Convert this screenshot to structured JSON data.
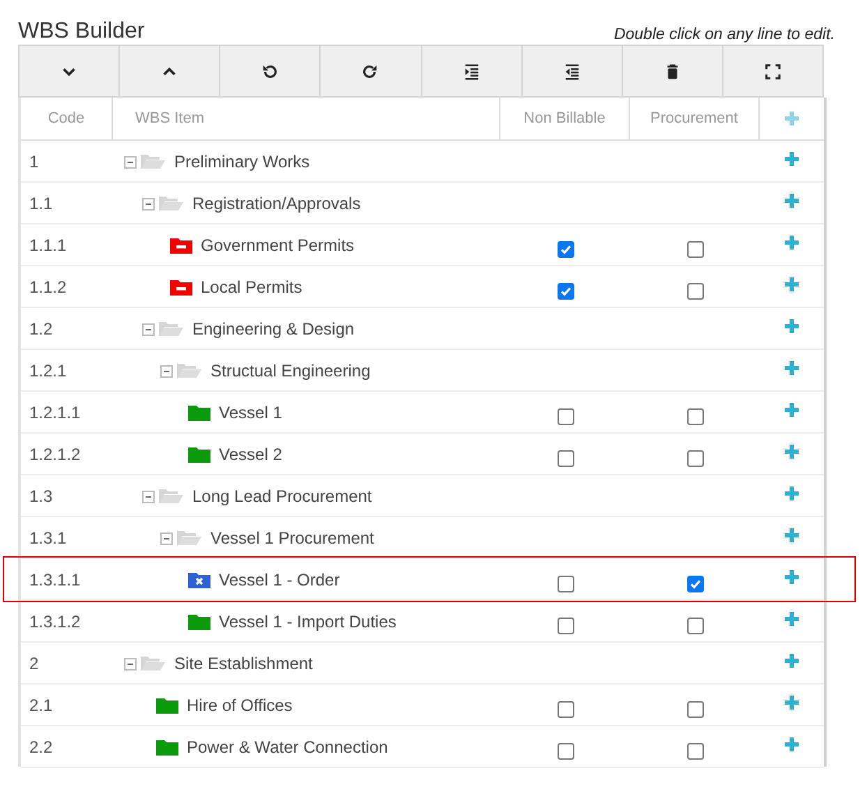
{
  "title": "WBS Builder",
  "hint": "Double click on any line to edit.",
  "toolbar": [
    {
      "kind": "down"
    },
    {
      "kind": "up"
    },
    {
      "kind": "undo"
    },
    {
      "kind": "redo"
    },
    {
      "kind": "indent"
    },
    {
      "kind": "outdent"
    },
    {
      "kind": "delete"
    },
    {
      "kind": "fullscreen"
    }
  ],
  "columns": [
    "Code",
    "WBS Item",
    "Non Billable",
    "Procurement"
  ],
  "items": [
    {
      "code": "1",
      "name": "Preliminary Works",
      "kind": "group",
      "expanded": true,
      "highlighted": false,
      "children": [
        {
          "code": "1.1",
          "name": "Registration/Approvals",
          "kind": "group",
          "expanded": true,
          "highlighted": false,
          "children": [
            {
              "code": "1.1.1",
              "name": "Government Permits",
              "kind": "blocked",
              "non_billable": true,
              "procurement": false,
              "highlighted": false
            },
            {
              "code": "1.1.2",
              "name": "Local Permits",
              "kind": "blocked",
              "non_billable": true,
              "procurement": false,
              "highlighted": false
            }
          ]
        },
        {
          "code": "1.2",
          "name": "Engineering & Design",
          "kind": "group",
          "expanded": true,
          "highlighted": false,
          "children": [
            {
              "code": "1.2.1",
              "name": "Structual Engineering",
              "kind": "group",
              "expanded": true,
              "highlighted": false,
              "children": [
                {
                  "code": "1.2.1.1",
                  "name": "Vessel 1",
                  "kind": "task",
                  "non_billable": false,
                  "procurement": false,
                  "highlighted": false
                },
                {
                  "code": "1.2.1.2",
                  "name": "Vessel 2",
                  "kind": "task",
                  "non_billable": false,
                  "procurement": false,
                  "highlighted": false
                }
              ]
            }
          ]
        },
        {
          "code": "1.3",
          "name": "Long Lead Procurement",
          "kind": "group",
          "expanded": true,
          "highlighted": false,
          "children": [
            {
              "code": "1.3.1",
              "name": "Vessel 1 Procurement",
              "kind": "group",
              "expanded": true,
              "highlighted": false,
              "children": [
                {
                  "code": "1.3.1.1",
                  "name": "Vessel 1 - Order",
                  "kind": "cancelled",
                  "non_billable": false,
                  "procurement": true,
                  "highlighted": true
                },
                {
                  "code": "1.3.1.2",
                  "name": "Vessel 1 - Import Duties",
                  "kind": "task",
                  "non_billable": false,
                  "procurement": false,
                  "highlighted": false
                }
              ]
            }
          ]
        }
      ]
    },
    {
      "code": "2",
      "name": "Site Establishment",
      "kind": "group",
      "expanded": true,
      "highlighted": false,
      "children": [
        {
          "code": "2.1",
          "name": "Hire of Offices",
          "kind": "task",
          "non_billable": false,
          "procurement": false,
          "highlighted": false
        },
        {
          "code": "2.2",
          "name": "Power & Water Connection",
          "kind": "task",
          "non_billable": false,
          "procurement": false,
          "highlighted": false
        }
      ]
    }
  ]
}
